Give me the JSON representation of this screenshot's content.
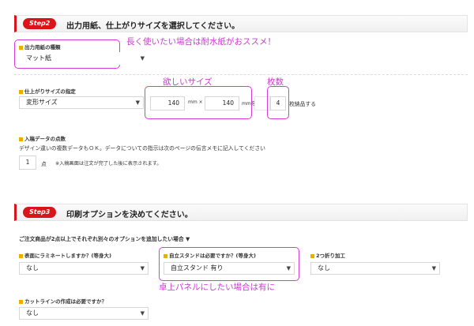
{
  "step2": {
    "badge": "Step2",
    "title": "出力用紙、仕上がりサイズを選択してください。"
  },
  "paper_type": {
    "label": "出力用紙の種類",
    "value": "マット紙"
  },
  "annotation_waterproof": "長く使いたい場合は耐水紙がおススメ！",
  "finish_size": {
    "label": "仕上がりサイズの指定",
    "select_value": "変形サイズ",
    "width": "140",
    "unit1": "mm ×",
    "height": "140",
    "unit2": "mmを",
    "quantity": "4",
    "suffix": "枚納品する"
  },
  "annotation_size": "欲しいサイズ",
  "annotation_count": "枚数",
  "data_count": {
    "label": "入稿データの点数",
    "description": "デザイン違いの複数データもＯＫ。データについての指示は次のページの伝言メモに記入してください",
    "value": "1",
    "unit": "点",
    "note": "※入稿画面は注文が完了した後に表示されます。"
  },
  "step3": {
    "badge": "Step3",
    "title": "印刷オプションを決めてください。"
  },
  "option_intro": "ご注文商品が2点以上でそれぞれ別々のオプションを追加したい場合 ▼",
  "laminate": {
    "label": "表面にラミネートしますか？(等身大)",
    "value": "なし"
  },
  "stand": {
    "label": "自立スタンドは必要ですか？(等身大)",
    "value": "自立スタンド 有り"
  },
  "fold": {
    "label": "2つ折り加工",
    "value": "なし"
  },
  "annotation_stand": "卓上パネルにしたい場合は有に",
  "cutline": {
    "label": "カットラインの作成は必要ですか？",
    "value": "なし"
  },
  "arrow_glyph": "▼"
}
